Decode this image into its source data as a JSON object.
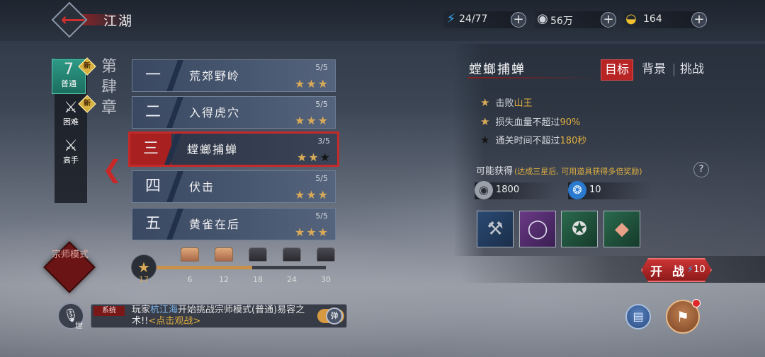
{
  "header": {
    "title": "江湖",
    "stamina": "24/77",
    "coins": "56万",
    "gold": "164"
  },
  "difficulty_tabs": [
    {
      "label": "普通",
      "glyph": "柒",
      "badge": "新",
      "active": true
    },
    {
      "label": "困难",
      "glyph": "⚔",
      "badge": "新",
      "active": false
    },
    {
      "label": "高手",
      "glyph": "⚔",
      "badge": "",
      "active": false
    }
  ],
  "chapter": "第肆章",
  "stages": [
    {
      "num": "一",
      "name": "荒郊野岭",
      "progress": "5/5",
      "stars": 3
    },
    {
      "num": "二",
      "name": "入得虎穴",
      "progress": "5/5",
      "stars": 3
    },
    {
      "num": "三",
      "name": "螳螂捕蝉",
      "progress": "3/5",
      "stars": 2
    },
    {
      "num": "四",
      "name": "伏击",
      "progress": "5/5",
      "stars": 3
    },
    {
      "num": "五",
      "name": "黄雀在后",
      "progress": "5/5",
      "stars": 3
    }
  ],
  "master_mode": "宗师模式",
  "star_progress": {
    "current": "17",
    "current_value": 17,
    "max_value": 30,
    "milestones": [
      "6",
      "12",
      "18",
      "24",
      "30"
    ],
    "opened": [
      true,
      true,
      false,
      false,
      false
    ]
  },
  "detail": {
    "stage_title": "螳螂捕蝉",
    "tabs": [
      "目标",
      "背景",
      "挑战"
    ],
    "active_tab": "目标",
    "goals": [
      {
        "prefix": "击败",
        "highlight": "山王",
        "suffix": "",
        "done": true
      },
      {
        "prefix": "损失血量不超过",
        "highlight": "90%",
        "suffix": "",
        "done": true
      },
      {
        "prefix": "通关时间不超过",
        "highlight": "180秒",
        "suffix": "",
        "done": false
      }
    ],
    "reward_header": "可能获得",
    "reward_note": "(达成三星后, 可用道具获得多倍奖励)",
    "help": "?",
    "rewards": [
      {
        "icon": "coin-icon",
        "value": "1800"
      },
      {
        "icon": "exp-orb-icon",
        "value": "10"
      }
    ],
    "items": [
      {
        "icon": "anvil-icon",
        "rarity": "blue"
      },
      {
        "icon": "ring-icon",
        "rarity": "purple"
      },
      {
        "icon": "emblem-icon",
        "rarity": "green"
      },
      {
        "icon": "ore-icon",
        "rarity": "green"
      }
    ],
    "fight_label": "开 战",
    "fight_cost": "10"
  },
  "chat": {
    "mic_tag": "世",
    "tag": "系统",
    "msg_a": "玩家",
    "player": "杭江海",
    "msg_b": "开始挑战宗师模式(普通)易容之术!!",
    "link": "<点击观战>",
    "toggle": "弹"
  },
  "colors": {
    "accent_red": "#b82424",
    "star_gold": "#d8aa58",
    "highlight_gold": "#e0b040",
    "active_tab_green": "#2e9a86"
  }
}
